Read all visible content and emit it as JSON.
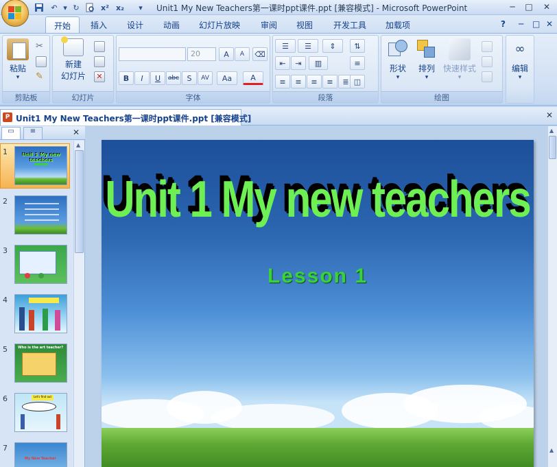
{
  "window": {
    "title": "Unit1 My New Teachers第一课时ppt课件.ppt [兼容模式] - Microsoft PowerPoint",
    "minimize": "─",
    "maximize": "□",
    "close": "✕"
  },
  "quick_access": [
    "save-icon",
    "undo-icon",
    "redo-icon",
    "print-preview-icon",
    "superscript-icon",
    "subscript-icon",
    "customize-icon"
  ],
  "tabs": [
    "开始",
    "插入",
    "设计",
    "动画",
    "幻灯片放映",
    "审阅",
    "视图",
    "开发工具",
    "加载项"
  ],
  "active_tab": "开始",
  "ribbon": {
    "clipboard": {
      "paste": "粘贴",
      "group": "剪贴板"
    },
    "slides": {
      "new_slide": "新建",
      "new_slide_line2": "幻灯片",
      "group": "幻灯片"
    },
    "font": {
      "font_name": "",
      "font_size": "20",
      "bold": "B",
      "italic": "I",
      "underline": "U",
      "strike": "abc",
      "shadow": "S",
      "spacing": "AV",
      "case": "Aa",
      "color": "A",
      "grow": "A",
      "shrink": "A",
      "group": "字体"
    },
    "paragraph": {
      "group": "段落"
    },
    "drawing": {
      "shapes": "形状",
      "arrange": "排列",
      "quick_styles": "快速样式",
      "group": "绘图"
    },
    "editing": {
      "edit": "编辑"
    }
  },
  "document": {
    "tab_title": "Unit1 My New Teachers第一课时ppt课件.ppt [兼容模式]",
    "close": "✕"
  },
  "slide_pane": {
    "close": "✕",
    "slide_numbers": [
      "1",
      "2",
      "3",
      "4",
      "5",
      "6",
      "7"
    ],
    "selected": 1,
    "thumb_texts": [
      "Unit 1 My new teachers",
      "",
      "",
      "",
      "Who is the art teacher?",
      "Let's find out",
      "My New Teacher"
    ]
  },
  "slide": {
    "title": "Unit 1 My new teachers",
    "subtitle": "Lesson 1"
  },
  "colors": {
    "title_green": "#6ef055",
    "subtitle_green": "#3ad13a",
    "ribbon_blue": "#d1e0f4",
    "selection_orange": "#f6b352"
  }
}
